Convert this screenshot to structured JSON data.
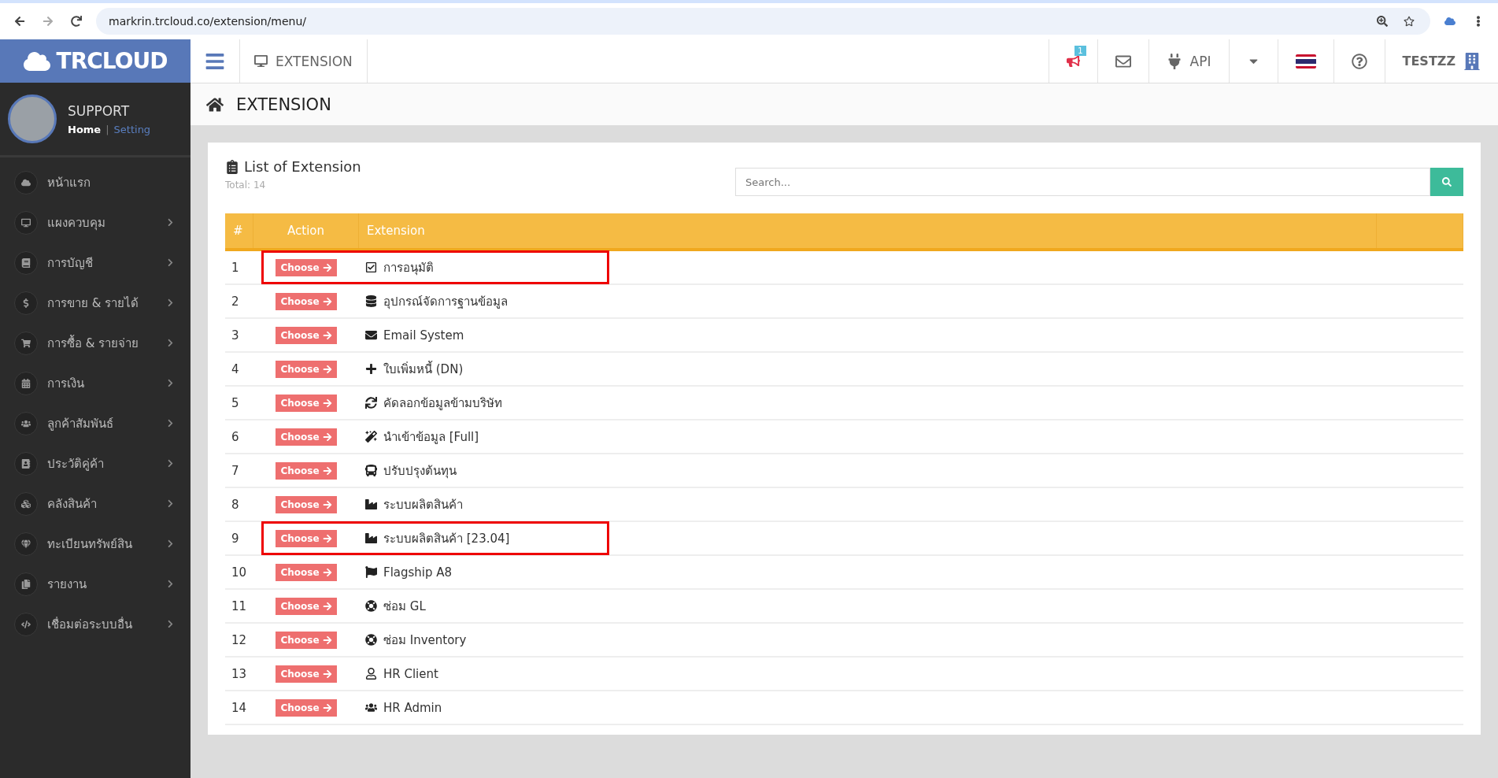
{
  "browser": {
    "url": "markrin.trcloud.co/extension/menu/"
  },
  "header": {
    "logo": "TRCLOUD",
    "module": "EXTENSION",
    "notification_count": "1",
    "api_label": "API",
    "company": "TESTZZ"
  },
  "profile": {
    "name": "SUPPORT",
    "separator": "|",
    "links": [
      {
        "label": "Home",
        "selected": true
      },
      {
        "label": "Setting",
        "selected": false
      }
    ]
  },
  "sidebar": {
    "items": [
      {
        "label": "หน้าแรก",
        "expandable": false
      },
      {
        "label": "แผงควบคุม",
        "expandable": true
      },
      {
        "label": "การบัญชี",
        "expandable": true
      },
      {
        "label": "การขาย & รายได้",
        "expandable": true
      },
      {
        "label": "การซื้อ & รายจ่าย",
        "expandable": true
      },
      {
        "label": "การเงิน",
        "expandable": true
      },
      {
        "label": "ลูกค้าสัมพันธ์",
        "expandable": true
      },
      {
        "label": "ประวัติคู่ค้า",
        "expandable": true
      },
      {
        "label": "คลังสินค้า",
        "expandable": true
      },
      {
        "label": "ทะเบียนทรัพย์สิน",
        "expandable": true
      },
      {
        "label": "รายงาน",
        "expandable": true
      },
      {
        "label": "เชื่อมต่อระบบอื่น",
        "expandable": true
      }
    ]
  },
  "breadcrumb": {
    "title": "EXTENSION"
  },
  "card": {
    "title": "List of Extension",
    "total": "Total: 14",
    "search": {
      "placeholder": "Search..."
    }
  },
  "table": {
    "columns": [
      "#",
      "Action",
      "Extension"
    ],
    "rows": [
      {
        "no": "1",
        "action": "Choose",
        "extension": "การอนุมัติ",
        "highlighted": true
      },
      {
        "no": "2",
        "action": "Choose",
        "extension": "อุปกรณ์จัดการฐานข้อมูล",
        "highlighted": false
      },
      {
        "no": "3",
        "action": "Choose",
        "extension": "Email System",
        "highlighted": false
      },
      {
        "no": "4",
        "action": "Choose",
        "extension": "ใบเพิ่มหนี้ (DN)",
        "highlighted": false
      },
      {
        "no": "5",
        "action": "Choose",
        "extension": "คัดลอกข้อมูลข้ามบริษัท",
        "highlighted": false
      },
      {
        "no": "6",
        "action": "Choose",
        "extension": "นำเข้าข้อมูล [Full]",
        "highlighted": false
      },
      {
        "no": "7",
        "action": "Choose",
        "extension": "ปรับปรุงต้นทุน",
        "highlighted": false
      },
      {
        "no": "8",
        "action": "Choose",
        "extension": "ระบบผลิตสินค้า",
        "highlighted": false
      },
      {
        "no": "9",
        "action": "Choose",
        "extension": "ระบบผลิตสินค้า [23.04]",
        "highlighted": true
      },
      {
        "no": "10",
        "action": "Choose",
        "extension": "Flagship A8",
        "highlighted": false
      },
      {
        "no": "11",
        "action": "Choose",
        "extension": "ซ่อม GL",
        "highlighted": false
      },
      {
        "no": "12",
        "action": "Choose",
        "extension": "ซ่อม Inventory",
        "highlighted": false
      },
      {
        "no": "13",
        "action": "Choose",
        "extension": "HR Client",
        "highlighted": false
      },
      {
        "no": "14",
        "action": "Choose",
        "extension": "HR Admin",
        "highlighted": false
      }
    ]
  }
}
